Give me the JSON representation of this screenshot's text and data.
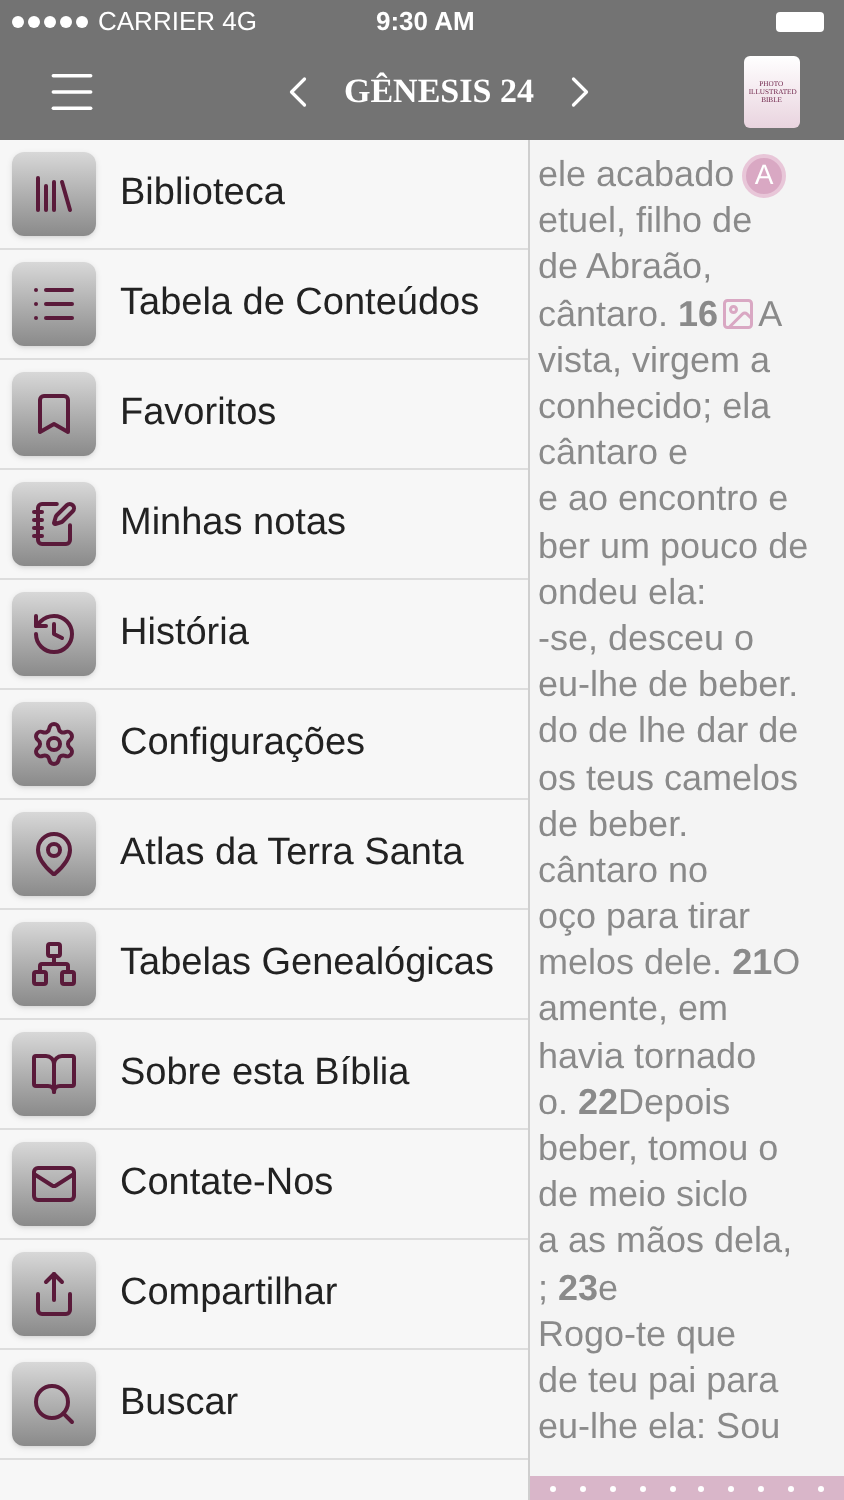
{
  "status_bar": {
    "carrier": "CARRIER 4G",
    "time": "9:30 AM"
  },
  "nav": {
    "title": "GÊNESIS 24",
    "logo": [
      "PHOTO",
      "ILLUSTRATED",
      "BIBLE"
    ]
  },
  "menu": [
    {
      "label": "Biblioteca"
    },
    {
      "label": "Tabela de Conteúdos"
    },
    {
      "label": "Favoritos"
    },
    {
      "label": "Minhas notas"
    },
    {
      "label": "História"
    },
    {
      "label": "Configurações"
    },
    {
      "label": "Atlas da Terra Santa"
    },
    {
      "label": "Tabelas Genealógicas"
    },
    {
      "label": "Sobre esta Bíblia"
    },
    {
      "label": "Contate-Nos"
    },
    {
      "label": "Compartilhar"
    },
    {
      "label": "Buscar"
    }
  ],
  "reader_lines": [
    {
      "kind": "badge",
      "text": "ele acabado",
      "marker": "A"
    },
    {
      "kind": "text",
      "text": "etuel, filho de"
    },
    {
      "kind": "text",
      "text": "de Abraão,"
    },
    {
      "kind": "image",
      "text": "cântaro. **16**",
      "after": "A"
    },
    {
      "kind": "text",
      "text": "vista, virgem a"
    },
    {
      "kind": "text",
      "text": "conhecido; ela"
    },
    {
      "kind": "text",
      "text": "cântaro e"
    },
    {
      "kind": "text",
      "text": "e ao encontro e"
    },
    {
      "kind": "text",
      "text": "ber um pouco de"
    },
    {
      "kind": "text",
      "text": "ondeu ela:"
    },
    {
      "kind": "text",
      "text": "-se, desceu o"
    },
    {
      "kind": "text",
      "text": "eu-lhe de beber."
    },
    {
      "kind": "text",
      "text": "do de lhe dar de"
    },
    {
      "kind": "text",
      "text": "os teus camelos"
    },
    {
      "kind": "text",
      "text": "de beber."
    },
    {
      "kind": "text",
      "text": "cântaro no"
    },
    {
      "kind": "text",
      "text": "oço para tirar"
    },
    {
      "kind": "text",
      "text": "melos dele. **21**O"
    },
    {
      "kind": "text",
      "text": "amente, em"
    },
    {
      "kind": "text",
      "text": "havia tornado"
    },
    {
      "kind": "text",
      "text": "o. **22**Depois"
    },
    {
      "kind": "text",
      "text": "beber, tomou o"
    },
    {
      "kind": "text",
      "text": "de meio siclo"
    },
    {
      "kind": "text",
      "text": "a as mãos dela,"
    },
    {
      "kind": "text",
      "text": "; **23**e"
    },
    {
      "kind": "text",
      "text": "Rogo-te que"
    },
    {
      "kind": "text",
      "text": "de teu pai para"
    },
    {
      "kind": "text",
      "text": "eu-lhe ela: Sou"
    }
  ]
}
